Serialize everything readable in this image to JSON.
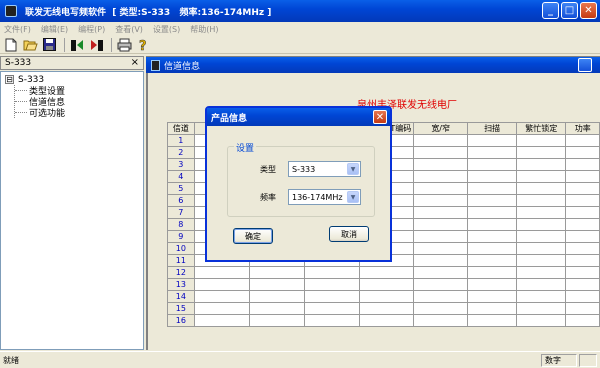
{
  "window": {
    "title": "联发无线电写频软件  [ 类型:S-333   频率:136-174MHz ]",
    "min_label": "_",
    "max_label": "□",
    "close_label": "✕"
  },
  "menu": [
    "文件(F)",
    "编辑(E)",
    "编程(P)",
    "查看(V)",
    "设置(S)",
    "帮助(H)"
  ],
  "toolbar": {
    "icons": [
      "new-icon",
      "open-icon",
      "save-icon",
      "read-radio-icon",
      "write-radio-icon",
      "print-icon",
      "help-icon"
    ]
  },
  "left_pane": {
    "header": "S-333",
    "close": "×",
    "tree": {
      "expander": "⊟",
      "root": "S-333",
      "children": [
        "类型设置",
        "信道信息",
        "可选功能"
      ]
    }
  },
  "child_window": {
    "title": "信道信息"
  },
  "company": "泉州丰泽联发无线电厂",
  "table": {
    "columns": [
      "信道",
      "",
      "",
      "",
      "T编码",
      "宽/窄",
      "扫描",
      "繁忙锁定",
      "功率"
    ],
    "rows": [
      "1",
      "2",
      "3",
      "4",
      "5",
      "6",
      "7",
      "8",
      "9",
      "10",
      "11",
      "12",
      "13",
      "14",
      "15",
      "16"
    ]
  },
  "dialog": {
    "title": "产品信息",
    "close": "✕",
    "group_label": "设置",
    "type_label": "类型",
    "type_value": "S-333",
    "freq_label": "频率",
    "freq_value": "136-174MHz",
    "ok_label": "确定",
    "cancel_label": "取消"
  },
  "status": {
    "left": "就绪",
    "pane1": "数字",
    "pane2": ""
  }
}
